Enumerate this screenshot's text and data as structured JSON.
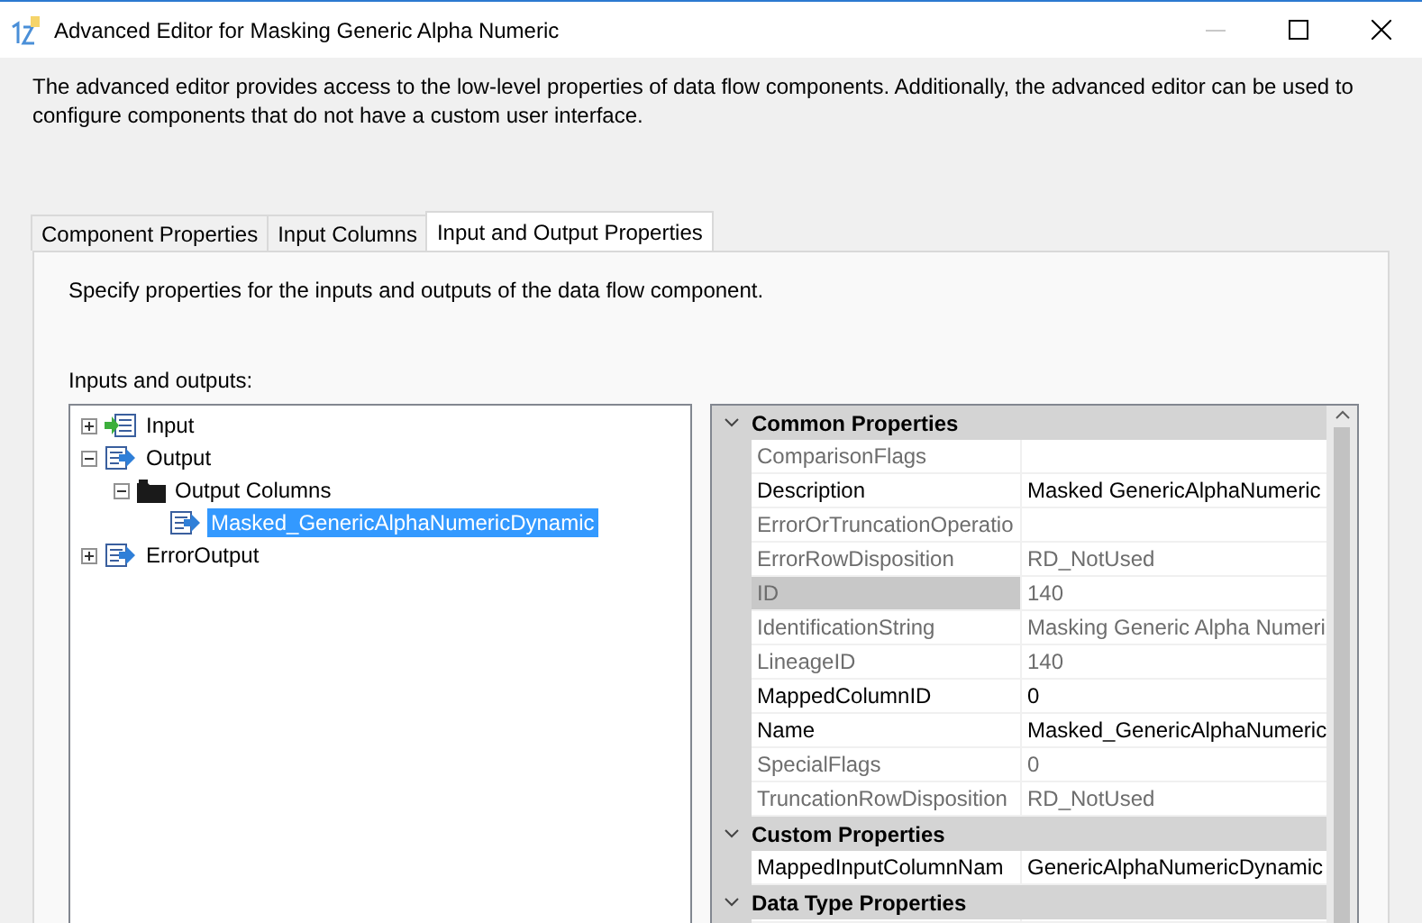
{
  "window": {
    "title": "Advanced Editor for Masking Generic Alpha Numeric",
    "minimize_disabled": true
  },
  "description": "The advanced editor provides access to the low-level properties of data flow components. Additionally, the advanced editor can be used to configure components that do not have a custom user interface.",
  "tabs": [
    {
      "label": "Component Properties",
      "selected": false
    },
    {
      "label": "Input Columns",
      "selected": false
    },
    {
      "label": "Input and Output Properties",
      "selected": true
    }
  ],
  "panel_hint": "Specify properties for the inputs and outputs of the data flow component.",
  "tree_label": "Inputs and outputs:",
  "tree": [
    {
      "label": "Input",
      "kind": "input",
      "expanded": false,
      "selected": false
    },
    {
      "label": "Output",
      "kind": "output",
      "expanded": true,
      "selected": false,
      "children": [
        {
          "label": "Output Columns",
          "kind": "folder",
          "expanded": true,
          "selected": false,
          "children": [
            {
              "label": "Masked_GenericAlphaNumericDynamic",
              "kind": "column",
              "selected": true
            }
          ]
        }
      ]
    },
    {
      "label": "ErrorOutput",
      "kind": "output",
      "expanded": false,
      "selected": false
    }
  ],
  "properties": [
    {
      "category": "Common Properties",
      "expanded": true,
      "rows": [
        {
          "name": "ComparisonFlags",
          "value": "",
          "readonly": true,
          "selected": false
        },
        {
          "name": "Description",
          "value": "Masked GenericAlphaNumeric",
          "readonly": false,
          "selected": false
        },
        {
          "name": "ErrorOrTruncationOperatio",
          "value": "",
          "readonly": true,
          "selected": false
        },
        {
          "name": "ErrorRowDisposition",
          "value": "RD_NotUsed",
          "readonly": true,
          "selected": false
        },
        {
          "name": "ID",
          "value": "140",
          "readonly": true,
          "selected": true
        },
        {
          "name": "IdentificationString",
          "value": "Masking Generic Alpha Numeri",
          "readonly": true,
          "selected": false
        },
        {
          "name": "LineageID",
          "value": "140",
          "readonly": true,
          "selected": false
        },
        {
          "name": "MappedColumnID",
          "value": "0",
          "readonly": false,
          "selected": false
        },
        {
          "name": "Name",
          "value": "Masked_GenericAlphaNumeric",
          "readonly": false,
          "selected": false
        },
        {
          "name": "SpecialFlags",
          "value": "0",
          "readonly": true,
          "selected": false
        },
        {
          "name": "TruncationRowDisposition",
          "value": "RD_NotUsed",
          "readonly": true,
          "selected": false
        }
      ]
    },
    {
      "category": "Custom Properties",
      "expanded": true,
      "rows": [
        {
          "name": "MappedInputColumnNam",
          "value": "GenericAlphaNumericDynamic",
          "readonly": false,
          "selected": false
        }
      ]
    },
    {
      "category": "Data Type Properties",
      "expanded": true
    }
  ]
}
